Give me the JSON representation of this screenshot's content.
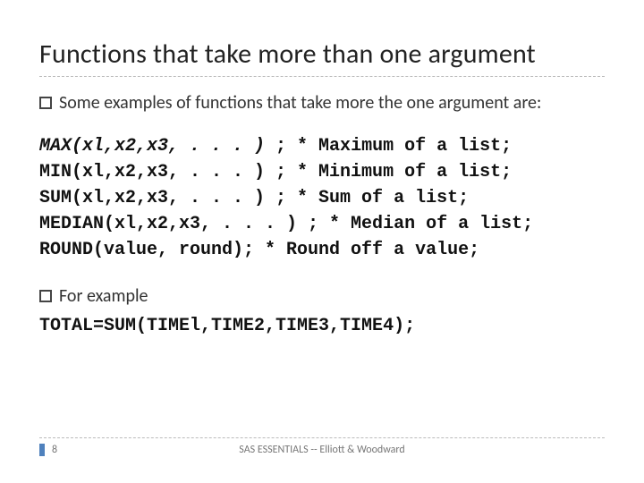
{
  "title": "Functions that take more than one argument",
  "bullets": {
    "intro": "Some examples of functions that take more the one argument are:",
    "for_example": "For example"
  },
  "code": {
    "line1_fn": "MAX(xl,x2,x3, . . . )",
    "line1_rest": " ; * Maximum of a list;",
    "line2": "MIN(xl,x2,x3, . . . ) ; * Minimum of a list;",
    "line3": "SUM(xl,x2,x3, . . . ) ; * Sum of a list;",
    "line4": "MEDIAN(xl,x2,x3, . . . ) ; * Median of a list;",
    "line5": "ROUND(value, round); * Round off a value;"
  },
  "example_code": "TOTAL=SUM(TIMEl,TIME2,TIME3,TIME4);",
  "footer": {
    "page": "8",
    "text": "SAS ESSENTIALS -- Elliott & Woodward"
  }
}
